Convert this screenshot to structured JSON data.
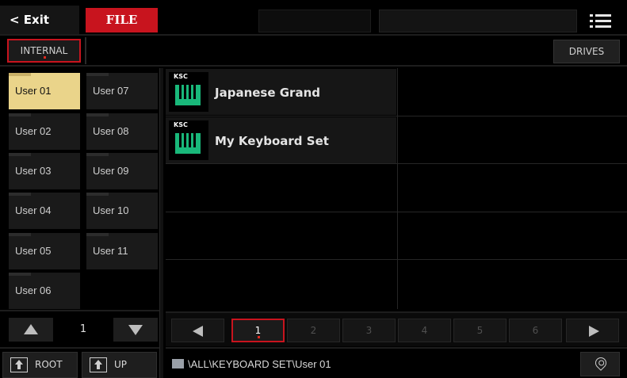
{
  "header": {
    "exit_label": "< Exit",
    "mode_label": "FILE",
    "menu_icon": "hamburger-list-icon"
  },
  "source": {
    "internal_label": "INTERNAL",
    "drives_label": "DRIVES"
  },
  "banks": [
    {
      "label": "User 01",
      "selected": true
    },
    {
      "label": "User 02"
    },
    {
      "label": "User 03"
    },
    {
      "label": "User 04"
    },
    {
      "label": "User 05"
    },
    {
      "label": "User 06"
    },
    {
      "label": "User 07"
    },
    {
      "label": "User 08"
    },
    {
      "label": "User 09"
    },
    {
      "label": "User 10"
    },
    {
      "label": "User 11"
    }
  ],
  "bank_pager": {
    "page": "1"
  },
  "nav": {
    "root_label": "ROOT",
    "up_label": "UP"
  },
  "files": [
    {
      "type_tag": "KSC",
      "name": "Japanese Grand"
    },
    {
      "type_tag": "KSC",
      "name": "My Keyboard Set"
    }
  ],
  "pages": [
    "1",
    "2",
    "3",
    "4",
    "5",
    "6"
  ],
  "current_page": "1",
  "path": "\\ALL\\KEYBOARD SET\\User 01",
  "colors": {
    "accent_red": "#c8141e",
    "selected_bank": "#ead48a",
    "file_icon_green": "#19b87a"
  }
}
